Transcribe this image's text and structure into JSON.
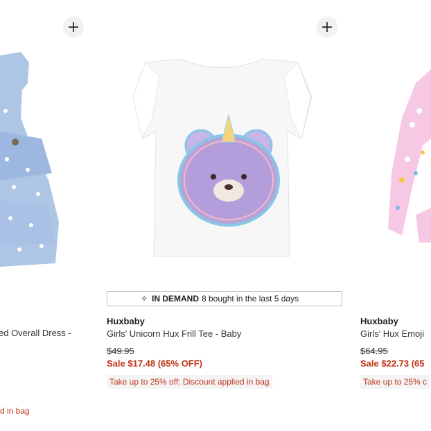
{
  "products": [
    {
      "name": "ed Overall Dress -",
      "promo": "d in bag"
    },
    {
      "brand": "Huxbaby",
      "name": "Girls' Unicorn Hux Frill Tee - Baby",
      "original_price": "$49.95",
      "sale_price": "Sale $17.48 (65% OFF)",
      "promo": "Take up to 25% off: Discount applied in bag",
      "badge": {
        "label": "IN DEMAND",
        "text": "8 bought in the last 5 days",
        "icon": "sparkle-icon"
      }
    },
    {
      "brand": "Huxbaby",
      "name": "Girls' Hux Emoji",
      "original_price": "$64.95",
      "sale_price": "Sale $22.73 (65",
      "promo": "Take up to 25% c"
    }
  ],
  "add_button_label": "+",
  "colors": {
    "sale": "#c0361c",
    "promo_bg": "#f4f4f4"
  }
}
